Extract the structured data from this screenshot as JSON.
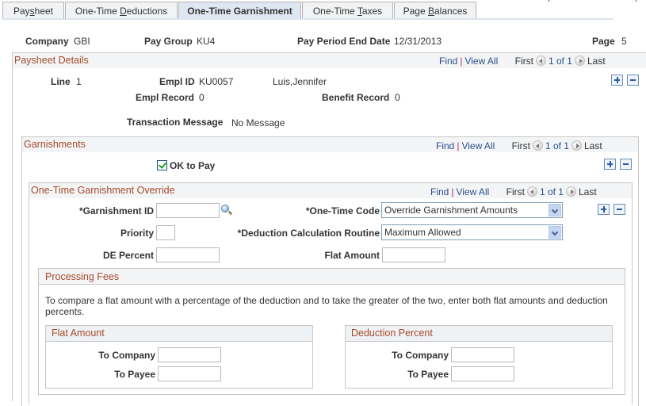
{
  "tabs": [
    {
      "label_pre": "Pay",
      "label_u": "s",
      "label_post": "heet",
      "active": false
    },
    {
      "label_pre": "One-Time ",
      "label_u": "D",
      "label_post": "eductions",
      "active": false
    },
    {
      "label_pre": "One-Time Garnishment",
      "label_u": "",
      "label_post": "",
      "active": true
    },
    {
      "label_pre": "One-Time ",
      "label_u": "T",
      "label_post": "axes",
      "active": false
    },
    {
      "label_pre": "Page ",
      "label_u": "B",
      "label_post": "alances",
      "active": false
    }
  ],
  "header": {
    "company_label": "Company",
    "company_value": "GBI",
    "pay_group_label": "Pay Group",
    "pay_group_value": "KU4",
    "period_end_label": "Pay Period End Date",
    "period_end_value": "12/31/2013",
    "page_label": "Page",
    "page_value": "5"
  },
  "nav": {
    "find": "Find",
    "separator": "|",
    "view_all": "View All",
    "first": "First",
    "count": "1 of 1",
    "last": "Last"
  },
  "paysheet_details": {
    "title": "Paysheet Details",
    "line_label": "Line",
    "line_value": "1",
    "empl_id_label": "Empl ID",
    "empl_id_value": "KU0057",
    "employee_name": "Luis,Jennifer",
    "empl_record_label": "Empl Record",
    "empl_record_value": "0",
    "benefit_record_label": "Benefit Record",
    "benefit_record_value": "0",
    "transaction_message_label": "Transaction Message",
    "transaction_message_value": "No Message"
  },
  "garnishments": {
    "title": "Garnishments",
    "ok_to_pay_label": "OK to Pay",
    "ok_to_pay_checked": true
  },
  "override": {
    "title": "One-Time Garnishment Override",
    "garnishment_id_label": "*Garnishment ID",
    "garnishment_id_value": "",
    "priority_label": "Priority",
    "priority_value": "",
    "de_percent_label": "DE Percent",
    "de_percent_value": "",
    "one_time_code_label": "*One-Time Code",
    "one_time_code_value": "Override Garnishment Amounts",
    "deduction_calc_label": "*Deduction Calculation Routine",
    "deduction_calc_value": "Maximum Allowed",
    "flat_amount_label": "Flat Amount",
    "flat_amount_value": ""
  },
  "processing_fees": {
    "title": "Processing Fees",
    "instructions": "To compare a flat amount with a percentage of the deduction and to take the greater of the two, enter both flat amounts and deduction percents.",
    "flat_amount": {
      "title": "Flat Amount",
      "to_company_label": "To Company",
      "to_company_value": "",
      "to_payee_label": "To Payee",
      "to_payee_value": ""
    },
    "deduction_percent": {
      "title": "Deduction Percent",
      "to_company_label": "To Company",
      "to_company_value": "",
      "to_payee_label": "To Payee",
      "to_payee_value": ""
    }
  }
}
